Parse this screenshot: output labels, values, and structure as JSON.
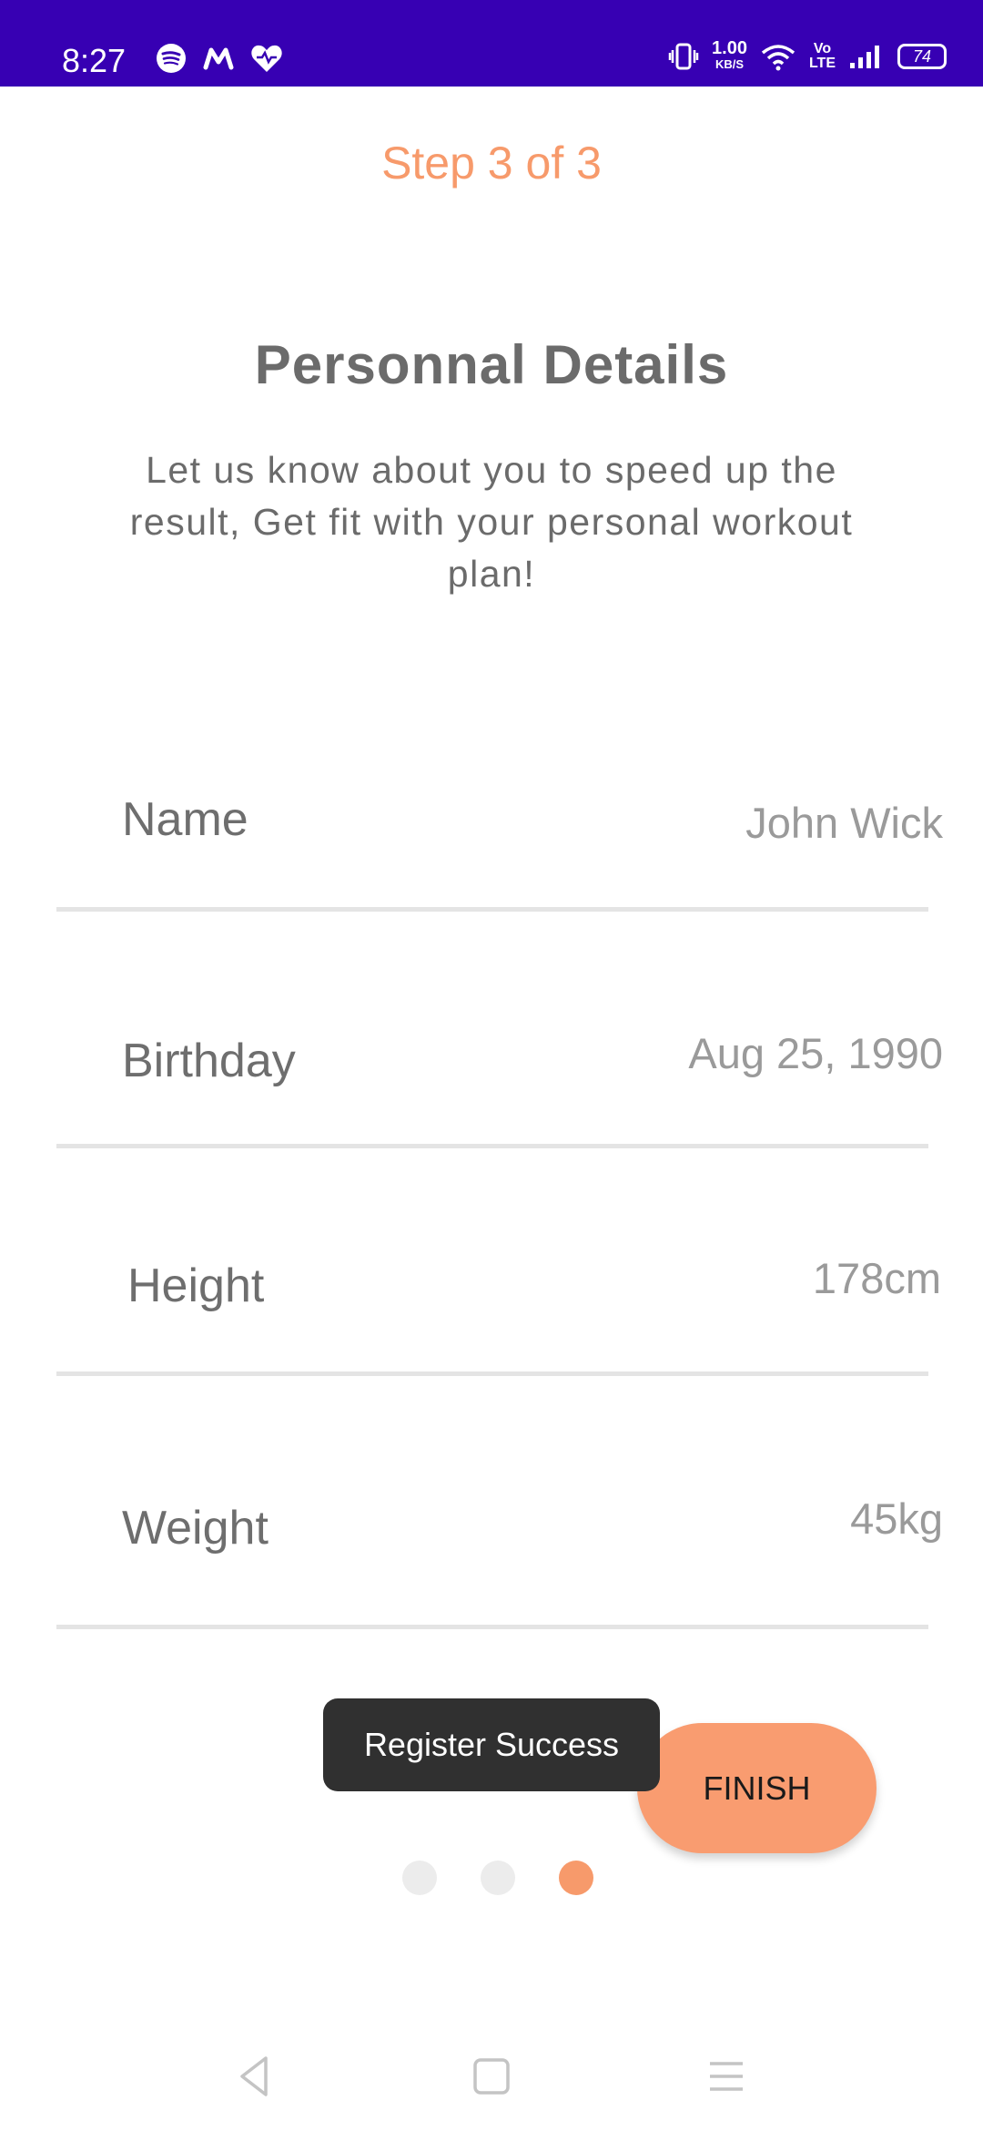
{
  "status_bar": {
    "time": "8:27",
    "speed_value": "1.00",
    "speed_unit": "KB/S",
    "volte_top": "Vo",
    "volte_bottom": "LTE",
    "battery": "74",
    "background_color": "#3700B3"
  },
  "stepper": {
    "step_label": "Step 3 of 3",
    "current_step": 3,
    "total_steps": 3,
    "accent_color": "#F79A6B"
  },
  "header": {
    "title": "Personnal Details",
    "subtitle": "Let us know about you to speed up the result, Get fit with your personal workout plan!"
  },
  "form": {
    "name": {
      "label": "Name",
      "value": "John Wick"
    },
    "birthday": {
      "label": "Birthday",
      "value": "Aug 25, 1990"
    },
    "height": {
      "label": "Height",
      "value": "178cm"
    },
    "weight": {
      "label": "Weight",
      "value": "45kg"
    }
  },
  "toast": {
    "message": "Register Success"
  },
  "actions": {
    "finish_label": "FINISH"
  },
  "icons": {
    "status_left": [
      "spotify-icon",
      "m-app-icon",
      "heart-icon"
    ],
    "status_right": [
      "vibrate-icon",
      "wifi-icon",
      "signal-icon",
      "battery-icon"
    ],
    "nav": [
      "back-icon",
      "home-icon",
      "menu-icon"
    ]
  }
}
